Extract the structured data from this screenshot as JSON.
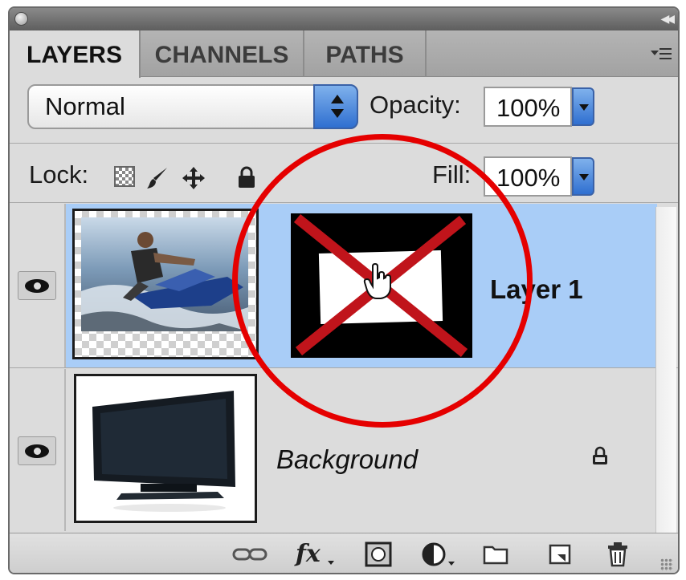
{
  "panel": {
    "tabs": [
      {
        "label": "LAYERS",
        "active": true
      },
      {
        "label": "CHANNELS",
        "active": false
      },
      {
        "label": "PATHS",
        "active": false
      }
    ],
    "menu_icon": "panel-menu-icon",
    "collapse_icon": "double-chevron-left-icon"
  },
  "blend": {
    "mode": "Normal"
  },
  "opacity": {
    "label": "Opacity:",
    "value": "100%"
  },
  "lock": {
    "label": "Lock:",
    "icons": [
      "lock-transparent-pixels-icon",
      "lock-image-pixels-icon",
      "lock-position-icon",
      "lock-all-icon"
    ]
  },
  "fill": {
    "label": "Fill:",
    "value": "100%"
  },
  "layers": [
    {
      "name": "Layer 1",
      "selected": true,
      "visible": true,
      "has_mask": true
    },
    {
      "name": "Background",
      "selected": false,
      "visible": true,
      "locked": true
    }
  ],
  "bottom_bar": {
    "fx_label": "fx",
    "icons": [
      "link-layers-icon",
      "layer-style-icon",
      "add-mask-icon",
      "adjustment-layer-icon",
      "new-group-icon",
      "new-layer-icon",
      "delete-layer-icon"
    ]
  },
  "colors": {
    "selection": "#a9cdf7",
    "annotation_red": "#e50000",
    "panel_bg": "#dcdcdc"
  }
}
